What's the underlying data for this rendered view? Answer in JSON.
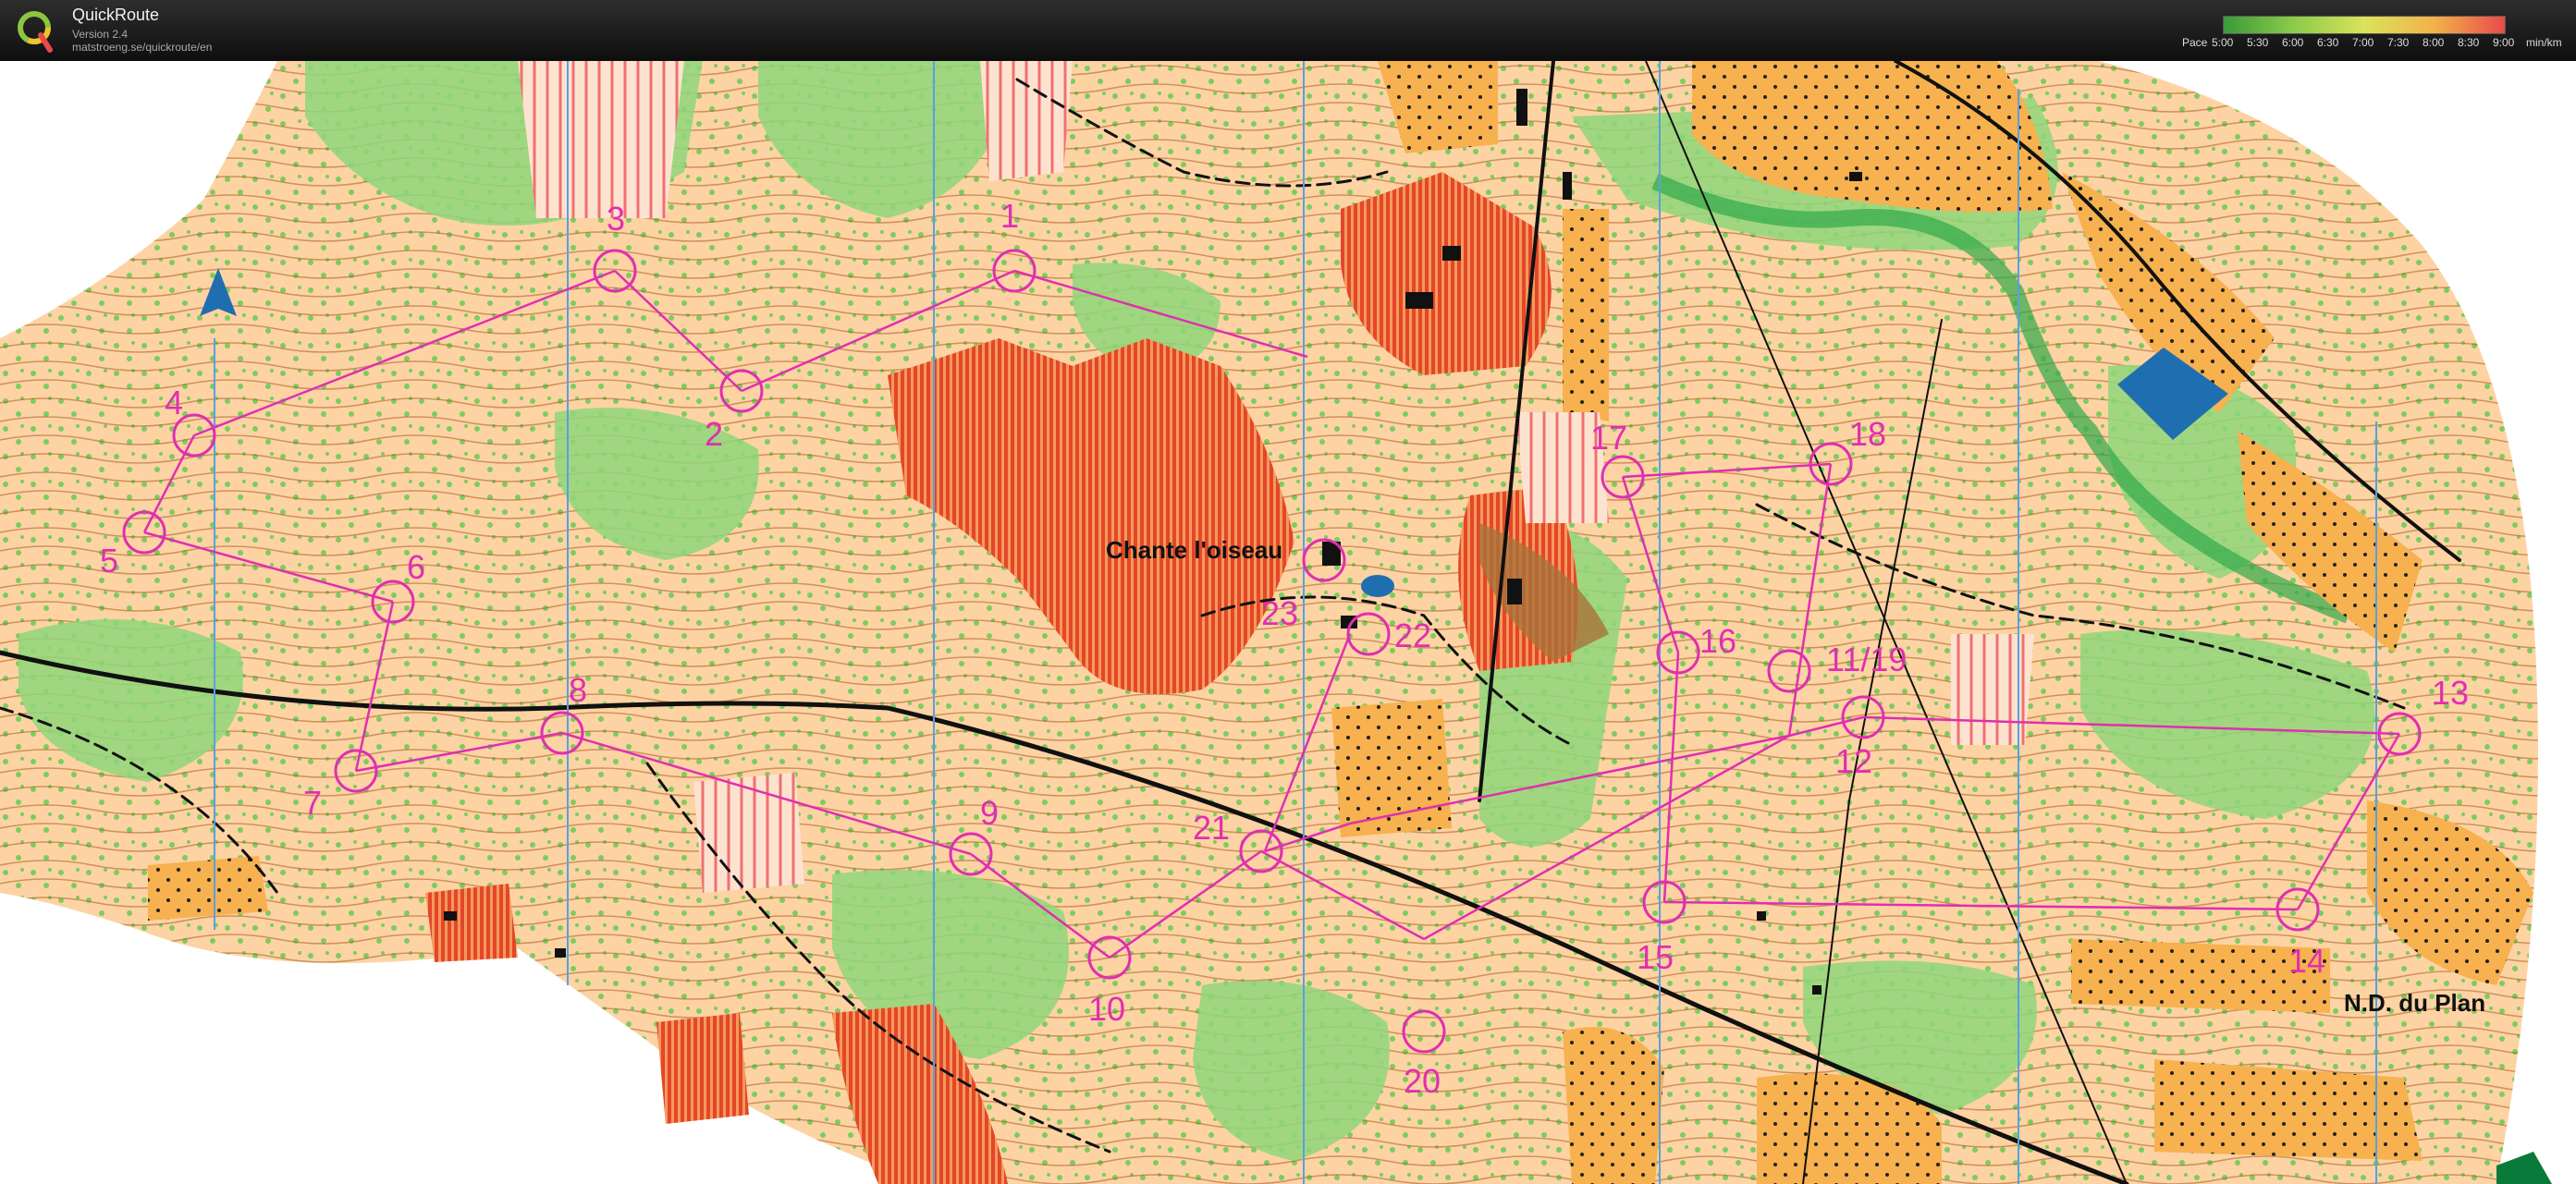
{
  "app": {
    "name": "QuickRoute",
    "version": "Version 2.4",
    "url": "matstroeng.se/quickroute/en",
    "logo_letter": "Q"
  },
  "pace_legend": {
    "prefix": "Pace",
    "ticks": [
      "5:00",
      "5:30",
      "6:00",
      "6:30",
      "7:00",
      "7:30",
      "8:00",
      "8:30",
      "9:00"
    ],
    "unit": "min/km",
    "colors": [
      "#3a9a3a",
      "#8ccb4a",
      "#d9e35a",
      "#f2b24a",
      "#e84a4a"
    ]
  },
  "map": {
    "colors": {
      "open_land": "#fdd3a4",
      "forest": "#ffffff",
      "green_vegetation": "#8fd67a",
      "orange_open": "#f7b14e",
      "out_of_bounds": "#e8743a",
      "course": "#e02fb0",
      "magnetic_north_line": "#5aa0e0",
      "water": "#1f6fb0",
      "contour": "#a85a1e"
    },
    "north_arrow_icon": "north-arrow-icon",
    "place_names": [
      "Chante l'oiseau",
      "N.D. du Plan"
    ],
    "controls": [
      "1",
      "2",
      "3",
      "4",
      "5",
      "6",
      "7",
      "8",
      "9",
      "10",
      "11/19",
      "12",
      "13",
      "14",
      "15",
      "16",
      "17",
      "18",
      "20",
      "21",
      "22",
      "23"
    ]
  }
}
